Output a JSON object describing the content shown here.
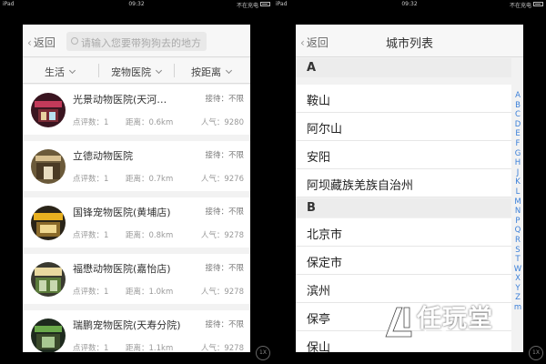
{
  "device": {
    "carrier": "iPad",
    "time": "09:32",
    "charge_text": "不在充电"
  },
  "left": {
    "back_label": "返回",
    "search_placeholder": "请输入您要带狗狗去的地方",
    "filters": [
      "生活",
      "宠物医院",
      "按距离"
    ],
    "clinics": [
      {
        "name": "光景动物医院(天河…",
        "orders": "接待：不限",
        "reviews": "点评数：1",
        "distance": "距离：0.6km",
        "popularity": "人气：9280"
      },
      {
        "name": "立德动物医院",
        "orders": "接待：不限",
        "reviews": "点评数：1",
        "distance": "距离：0.7km",
        "popularity": "人气：9276"
      },
      {
        "name": "国锋宠物医院(黄埔店)",
        "orders": "接待：不限",
        "reviews": "点评数：1",
        "distance": "距离：0.8km",
        "popularity": "人气：9278"
      },
      {
        "name": "福懋动物医院(嘉怡店)",
        "orders": "接待：不限",
        "reviews": "点评数：1",
        "distance": "距离：1.0km",
        "popularity": "人气：9278"
      },
      {
        "name": "瑞鹏宠物医院(天寿分院)",
        "orders": "接待：不限",
        "reviews": "点评数：1",
        "distance": "距离：1.1km",
        "popularity": "人气：9278"
      }
    ]
  },
  "right": {
    "back_label": "返回",
    "title": "城市列表",
    "sections": [
      {
        "letter": "A",
        "cities": [
          "鞍山",
          "阿尔山",
          "安阳",
          "阿坝藏族羌族自治州"
        ]
      },
      {
        "letter": "B",
        "cities": [
          "北京市",
          "保定市",
          "滨州",
          "保亭",
          "保山"
        ]
      }
    ],
    "index": [
      "A",
      "B",
      "C",
      "D",
      "E",
      "F",
      "G",
      "H",
      "J",
      "K",
      "L",
      "M",
      "N",
      "P",
      "Q",
      "R",
      "S",
      "T",
      "W",
      "X",
      "Y",
      "Z",
      "m"
    ]
  },
  "zoom_label": "1X",
  "watermark": {
    "title": "任玩堂",
    "subtitle": "AppGame.com"
  },
  "colors": {
    "link_blue": "#3a7fd9",
    "background": "#000000"
  }
}
